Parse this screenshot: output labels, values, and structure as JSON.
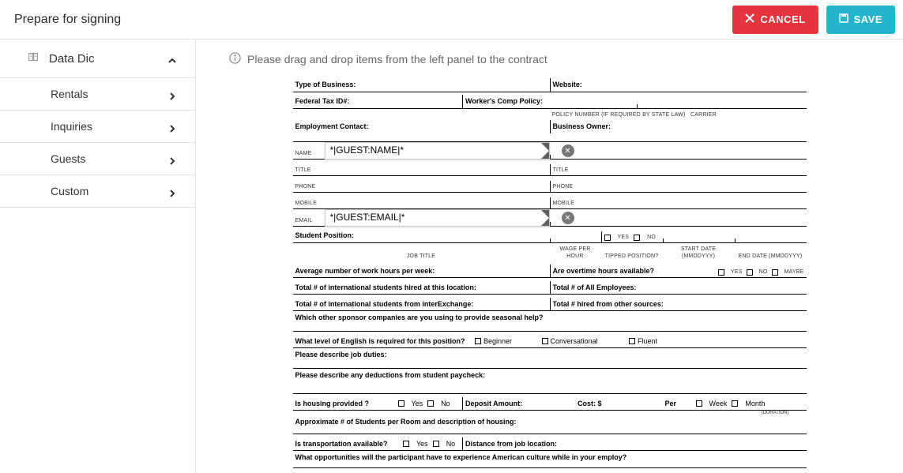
{
  "header": {
    "title": "Prepare for signing",
    "cancel": "CANCEL",
    "save": "SAVE"
  },
  "instruction": "Please drag and drop items from the left panel to the contract",
  "sidebar": {
    "title": "Data Dic",
    "items": [
      {
        "label": "Rentals"
      },
      {
        "label": "Inquiries"
      },
      {
        "label": "Guests"
      },
      {
        "label": "Custom"
      }
    ]
  },
  "tokens": {
    "name": "*|GUEST:NAME|*",
    "email": "*|GUEST:EMAIL|*"
  },
  "doc": {
    "type_of_business": "Type of Business:",
    "website": "Website:",
    "federal_tax": "Federal Tax ID#:",
    "workers_comp": "Worker's Comp Policy:",
    "policy_number": "POLICY NUMBER (IF REQUIRED BY STATE LAW)",
    "carrier": "CARRIER",
    "employment_contact": "Employment Contact:",
    "business_owner": "Business Owner:",
    "name": "NAME",
    "title": "TITLE",
    "phone": "PHONE",
    "mobile": "MOBILE",
    "email": "EMAIL",
    "student_position": "Student Position:",
    "yes": "Yes",
    "no": "No",
    "job_title": "JOB TITLE",
    "wage": "WAGE PER HOUR",
    "tipped": "TIPPED POSITION?",
    "start": "START DATE (MMDDYYY)",
    "end": "END DATE (MMDDYYY)",
    "avg_hours": "Average number of work hours per week:",
    "overtime": "Are overtime hours available?",
    "maybe": "Maybe",
    "intl_hired": "Total # of international students hired at this location:",
    "all_emp": "Total # of All Employees:",
    "intl_inter": "Total # of international students from interExchange:",
    "other_sources": "Total # hired from other sources:",
    "sponsors": "Which other sponsor companies are you using to provide seasonal help?",
    "english_q": "What level of English is required for this position?",
    "beginner": "Beginner",
    "conversational": "Conversational",
    "fluent": "Fluent",
    "duties": "Please describe job duties:",
    "deductions": "Please describe any deductions from student paycheck:",
    "housing": "Is housing provided ?",
    "deposit": "Deposit Amount:",
    "cost": "Cost: $",
    "per": "Per",
    "week": "Week",
    "month": "Month",
    "duration": "(DURATION)",
    "approx": "Approximate # of Students per Room and description of housing:",
    "transport": "Is transportation available?",
    "distance": "Distance from job location:",
    "culture": "What opportunities will the participant have to experience American culture while in your employ?"
  }
}
